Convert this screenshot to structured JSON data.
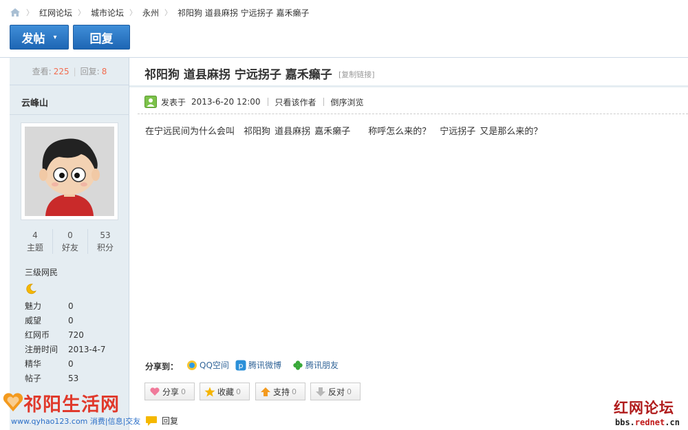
{
  "breadcrumb": {
    "items": [
      "红网论坛",
      "城市论坛",
      "永州",
      "祁阳狗 道县麻拐 宁远拐子 嘉禾癞子"
    ],
    "separator": "›"
  },
  "toolbar": {
    "post_label": "发帖",
    "reply_label": "回复"
  },
  "stats": {
    "views_label": "查看:",
    "views": "225",
    "replies_label": "回复:",
    "replies": "8"
  },
  "thread": {
    "title": "祁阳狗 道县麻拐 宁远拐子 嘉禾癞子",
    "copy_link": "[复制链接]",
    "posted_label": "发表于",
    "posted_time": "2013-6-20 12:00",
    "only_author": "只看该作者",
    "reverse": "倒序浏览",
    "content": "在宁远民间为什么会叫　祁阳狗 道县麻拐 嘉禾癞子　　称呼怎么来的？　宁远拐子 又是那么来的？"
  },
  "author": {
    "name": "云峰山",
    "counts": [
      {
        "value": "4",
        "label": "主题"
      },
      {
        "value": "0",
        "label": "好友"
      },
      {
        "value": "53",
        "label": "积分"
      }
    ],
    "rank": "三级网民",
    "info": [
      {
        "key": "魅力",
        "value": "0"
      },
      {
        "key": "威望",
        "value": "0"
      },
      {
        "key": "红网币",
        "value": "720"
      },
      {
        "key": "注册时间",
        "value": "2013-4-7"
      },
      {
        "key": "精华",
        "value": "0"
      },
      {
        "key": "帖子",
        "value": "53"
      }
    ]
  },
  "share": {
    "label": "分享到：",
    "items": [
      "QQ空间",
      "腾讯微博",
      "腾讯朋友"
    ]
  },
  "actions": [
    {
      "label": "分享",
      "count": "0",
      "icon": "heart-icon"
    },
    {
      "label": "收藏",
      "count": "0",
      "icon": "star-icon"
    },
    {
      "label": "支持",
      "count": "0",
      "icon": "thumb-up-icon"
    },
    {
      "label": "反对",
      "count": "0",
      "icon": "thumb-down-icon"
    }
  ],
  "reply_link": "回复",
  "watermark_left": {
    "title": "祁阳生活网",
    "url_line": "www.qyhao123.com 消费|信息|交友"
  },
  "watermark_right": {
    "title": "红网论坛",
    "url_prefix": "bbs.",
    "url_red": "rednet",
    "url_suffix": ".cn"
  },
  "colors": {
    "accent_blue": "#1e66b4",
    "sidebar_bg": "#e5edf2",
    "count_orange": "#f26c4f",
    "link_blue": "#336699"
  }
}
